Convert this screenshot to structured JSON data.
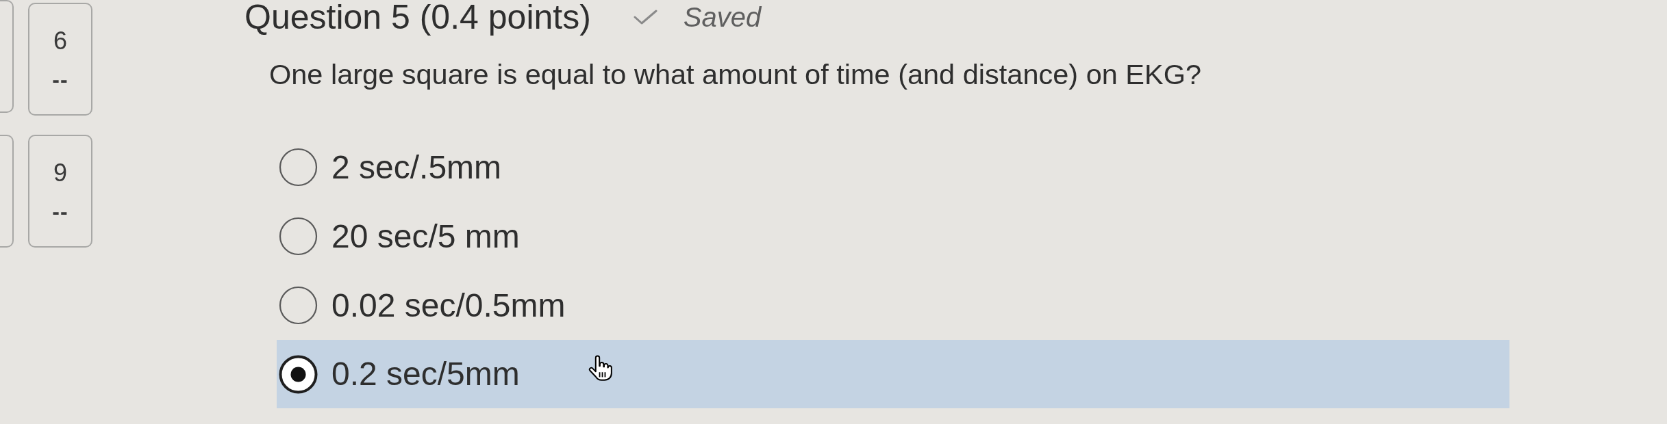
{
  "question_nav": [
    {
      "number": "6",
      "answer": "--"
    },
    {
      "number": "9",
      "answer": "--"
    }
  ],
  "question": {
    "title": "Question 5 (0.4 points)",
    "save_status": "Saved",
    "text": "One large square is equal to what amount of time (and distance) on EKG?"
  },
  "options": [
    {
      "label": "2 sec/.5mm",
      "selected": false
    },
    {
      "label": "20 sec/5 mm",
      "selected": false
    },
    {
      "label": "0.02 sec/0.5mm",
      "selected": false
    },
    {
      "label": "0.2 sec/5mm",
      "selected": true
    }
  ]
}
